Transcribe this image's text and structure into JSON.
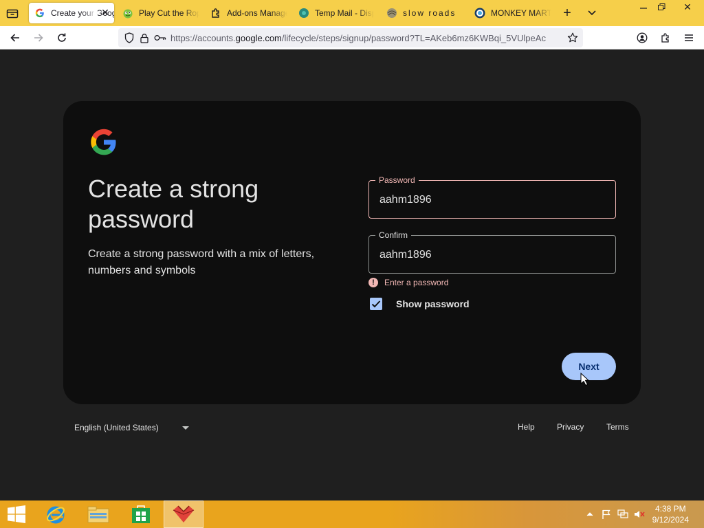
{
  "browser": {
    "tabs": [
      {
        "title": "Create your Google Account",
        "icon": "google-g-icon",
        "active": true
      },
      {
        "title": "Play Cut the Rope",
        "icon": "cut-the-rope-icon",
        "active": false
      },
      {
        "title": "Add-ons Manager",
        "icon": "puzzle-icon",
        "active": false
      },
      {
        "title": "Temp Mail - Disposable",
        "icon": "tempmail-icon",
        "active": false
      },
      {
        "title": "slow roads",
        "icon": "slow-roads-icon",
        "active": false
      },
      {
        "title": "MONKEY MART",
        "icon": "monkey-mart-icon",
        "active": false
      }
    ],
    "url_prefix": "https://accounts.",
    "url_domain": "google.com",
    "url_rest": "/lifecycle/steps/signup/password?TL=AKeb6mz6KWBqi_5VUlpeAc"
  },
  "signup": {
    "title": "Create a strong password",
    "subtitle": "Create a strong password with a mix of letters, numbers and symbols",
    "password_label": "Password",
    "password_value": "aahm1896",
    "confirm_label": "Confirm",
    "confirm_value": "aahm1896",
    "error_text": "Enter a password",
    "show_password_label": "Show password",
    "show_password_checked": true,
    "next_label": "Next"
  },
  "footer": {
    "language": "English (United States)",
    "help": "Help",
    "privacy": "Privacy",
    "terms": "Terms"
  },
  "taskbar": {
    "time": "4:38 PM",
    "date": "9/12/2024"
  },
  "colors": {
    "tabbar": "#f6cf4a",
    "card": "#0e0e0e",
    "page": "#1f1f1f",
    "accent": "#a8c7fa",
    "error": "#f2b8b5"
  }
}
